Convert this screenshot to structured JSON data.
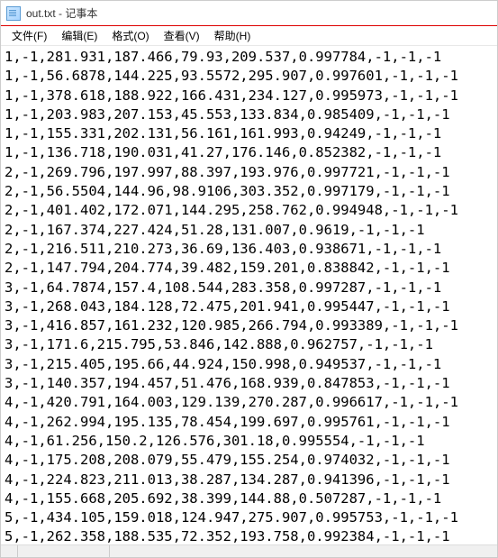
{
  "window": {
    "title": "out.txt - 记事本"
  },
  "menu": {
    "file": "文件(F)",
    "edit": "编辑(E)",
    "format": "格式(O)",
    "view": "查看(V)",
    "help": "帮助(H)"
  },
  "lines": [
    "1,-1,281.931,187.466,79.93,209.537,0.997784,-1,-1,-1",
    "1,-1,56.6878,144.225,93.5572,295.907,0.997601,-1,-1,-1",
    "1,-1,378.618,188.922,166.431,234.127,0.995973,-1,-1,-1",
    "1,-1,203.983,207.153,45.553,133.834,0.985409,-1,-1,-1",
    "1,-1,155.331,202.131,56.161,161.993,0.94249,-1,-1,-1",
    "1,-1,136.718,190.031,41.27,176.146,0.852382,-1,-1,-1",
    "2,-1,269.796,197.997,88.397,193.976,0.997721,-1,-1,-1",
    "2,-1,56.5504,144.96,98.9106,303.352,0.997179,-1,-1,-1",
    "2,-1,401.402,172.071,144.295,258.762,0.994948,-1,-1,-1",
    "2,-1,167.374,227.424,51.28,131.007,0.9619,-1,-1,-1",
    "2,-1,216.511,210.273,36.69,136.403,0.938671,-1,-1,-1",
    "2,-1,147.794,204.774,39.482,159.201,0.838842,-1,-1,-1",
    "3,-1,64.7874,157.4,108.544,283.358,0.997287,-1,-1,-1",
    "3,-1,268.043,184.128,72.475,201.941,0.995447,-1,-1,-1",
    "3,-1,416.857,161.232,120.985,266.794,0.993389,-1,-1,-1",
    "3,-1,171.6,215.795,53.846,142.888,0.962757,-1,-1,-1",
    "3,-1,215.405,195.66,44.924,150.998,0.949537,-1,-1,-1",
    "3,-1,140.357,194.457,51.476,168.939,0.847853,-1,-1,-1",
    "4,-1,420.791,164.003,129.139,270.287,0.996617,-1,-1,-1",
    "4,-1,262.994,195.135,78.454,199.697,0.995761,-1,-1,-1",
    "4,-1,61.256,150.2,126.576,301.18,0.995554,-1,-1,-1",
    "4,-1,175.208,208.079,55.479,155.254,0.974032,-1,-1,-1",
    "4,-1,224.823,211.013,38.287,134.287,0.941396,-1,-1,-1",
    "4,-1,155.668,205.692,38.399,144.88,0.507287,-1,-1,-1",
    "5,-1,434.105,159.018,124.947,275.907,0.995753,-1,-1,-1",
    "5,-1,262.358,188.535,72.352,193.758,0.992384,-1,-1,-1"
  ]
}
